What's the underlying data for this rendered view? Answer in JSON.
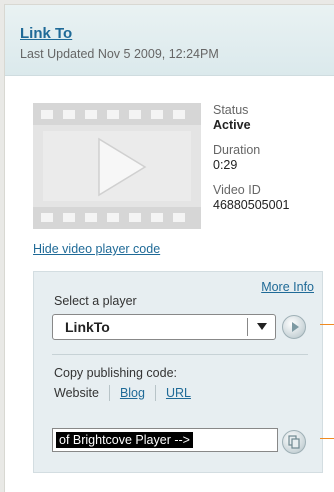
{
  "header": {
    "title": "Link To",
    "updated": "Last Updated Nov 5 2009, 12:24PM"
  },
  "video": {
    "thumbnail_icon": "play-icon",
    "status_label": "Status",
    "status_value": "Active",
    "duration_label": "Duration",
    "duration_value": "0:29",
    "id_label": "Video ID",
    "id_value": "46880505001"
  },
  "hide_link": "Hide video player code",
  "player_box": {
    "more_info": "More Info",
    "select_label": "Select a player",
    "selected_player": "LinkTo",
    "copy_label": "Copy publishing code:",
    "tabs": [
      "Website",
      "Blog",
      "URL"
    ],
    "code_value": "of Brightcove Player -->"
  },
  "colors": {
    "link": "#1f6a97",
    "header_bg": "#dfecef",
    "box_bg": "#e7eef1",
    "callout": "#f08a20"
  }
}
